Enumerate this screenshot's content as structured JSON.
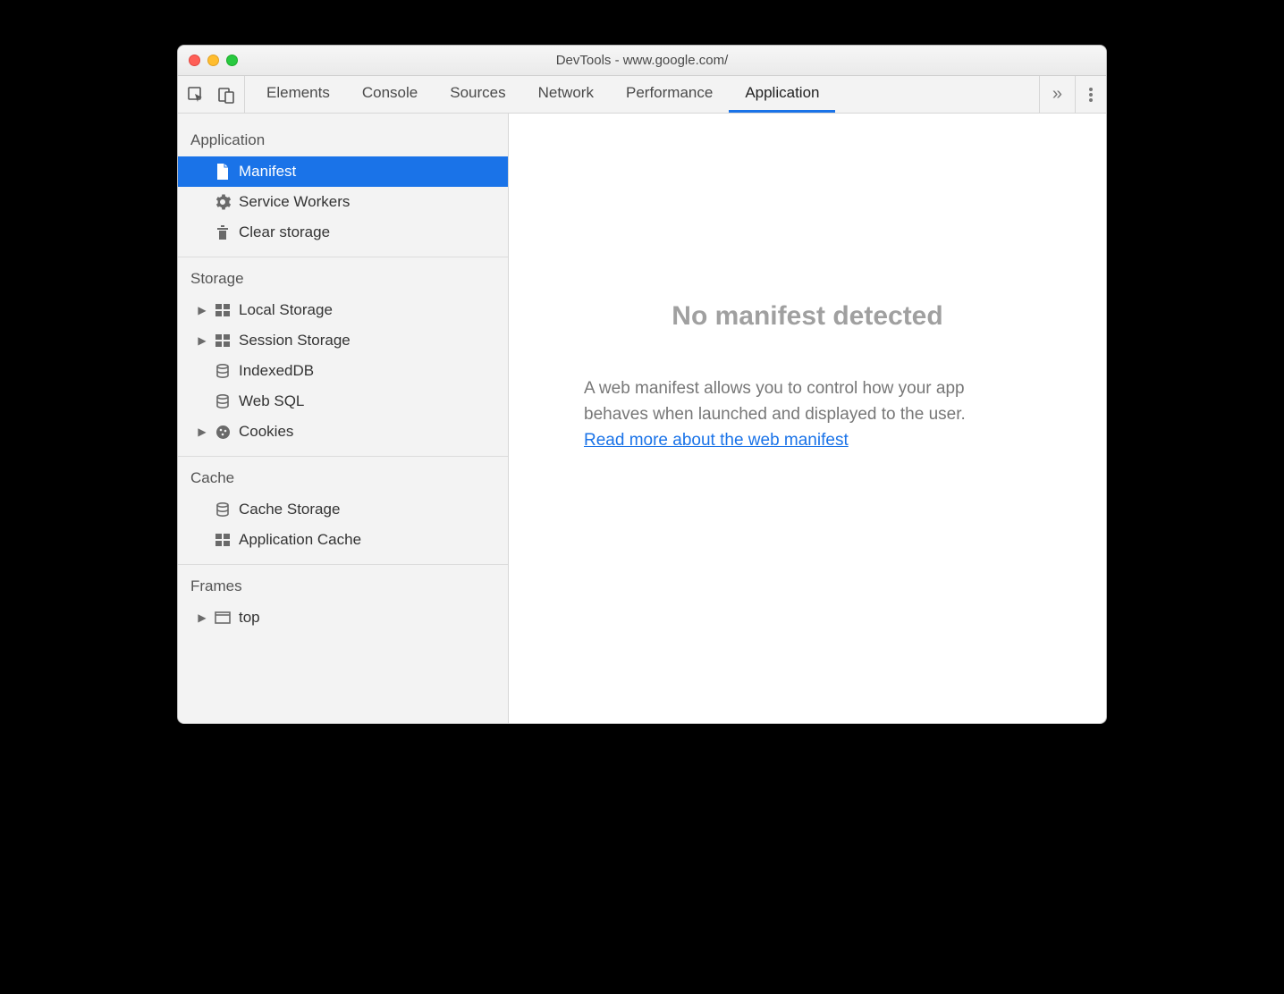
{
  "window": {
    "title": "DevTools - www.google.com/"
  },
  "tabs": {
    "items": [
      {
        "label": "Elements"
      },
      {
        "label": "Console"
      },
      {
        "label": "Sources"
      },
      {
        "label": "Network"
      },
      {
        "label": "Performance"
      },
      {
        "label": "Application"
      }
    ],
    "active_index": 5
  },
  "sidebar": {
    "sections": [
      {
        "title": "Application",
        "items": [
          {
            "label": "Manifest",
            "icon": "file",
            "expandable": false,
            "selected": true
          },
          {
            "label": "Service Workers",
            "icon": "gear",
            "expandable": false
          },
          {
            "label": "Clear storage",
            "icon": "trash",
            "expandable": false
          }
        ]
      },
      {
        "title": "Storage",
        "items": [
          {
            "label": "Local Storage",
            "icon": "grid",
            "expandable": true
          },
          {
            "label": "Session Storage",
            "icon": "grid",
            "expandable": true
          },
          {
            "label": "IndexedDB",
            "icon": "db",
            "expandable": false
          },
          {
            "label": "Web SQL",
            "icon": "db",
            "expandable": false
          },
          {
            "label": "Cookies",
            "icon": "cookie",
            "expandable": true
          }
        ]
      },
      {
        "title": "Cache",
        "items": [
          {
            "label": "Cache Storage",
            "icon": "db",
            "expandable": false
          },
          {
            "label": "Application Cache",
            "icon": "grid",
            "expandable": false
          }
        ]
      },
      {
        "title": "Frames",
        "items": [
          {
            "label": "top",
            "icon": "frame",
            "expandable": true
          }
        ]
      }
    ]
  },
  "main": {
    "title": "No manifest detected",
    "description": "A web manifest allows you to control how your app behaves when launched and displayed to the user.",
    "link_text": "Read more about the web manifest"
  }
}
